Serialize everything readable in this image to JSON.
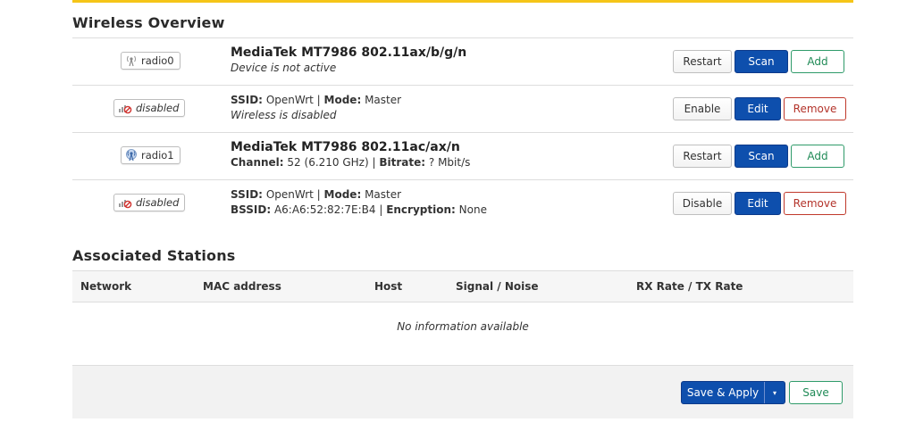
{
  "colors": {
    "accent_bar": "#f5c518",
    "primary": "#0e4fad",
    "positive": "#1f8a56",
    "negative": "#b3332a"
  },
  "overview": {
    "heading": "Wireless Overview",
    "rows": [
      {
        "badge": {
          "icon": "radio-antenna-icon",
          "label": "radio0"
        },
        "title": "MediaTek MT7986 802.11ax/b/g/n",
        "status": "Device is not active",
        "actions": [
          "Restart",
          "Scan",
          "Add"
        ]
      },
      {
        "badge": {
          "icon": "wifi-disabled-icon",
          "label": "disabled"
        },
        "ssid_label": "SSID:",
        "ssid": "OpenWrt",
        "mode_label": "Mode:",
        "mode": "Master",
        "status": "Wireless is disabled",
        "actions": [
          "Enable",
          "Edit",
          "Remove"
        ]
      },
      {
        "badge": {
          "icon": "radio-antenna-icon",
          "label": "radio1"
        },
        "title": "MediaTek MT7986 802.11ac/ax/n",
        "channel_label": "Channel:",
        "channel": "52 (6.210 GHz)",
        "bitrate_label": "Bitrate:",
        "bitrate": "? Mbit/s",
        "actions": [
          "Restart",
          "Scan",
          "Add"
        ]
      },
      {
        "badge": {
          "icon": "wifi-disabled-icon",
          "label": "disabled"
        },
        "ssid_label": "SSID:",
        "ssid": "OpenWrt",
        "mode_label": "Mode:",
        "mode": "Master",
        "bssid_label": "BSSID:",
        "bssid": "A6:A6:52:82:7E:B4",
        "encryption_label": "Encryption:",
        "encryption": "None",
        "actions": [
          "Disable",
          "Edit",
          "Remove"
        ]
      }
    ]
  },
  "stations": {
    "heading": "Associated Stations",
    "columns": [
      "Network",
      "MAC address",
      "Host",
      "Signal / Noise",
      "RX Rate / TX Rate"
    ],
    "empty": "No information available"
  },
  "footer": {
    "save_apply": "Save & Apply",
    "dropdown": "▾",
    "save": "Save"
  },
  "separator": "|"
}
